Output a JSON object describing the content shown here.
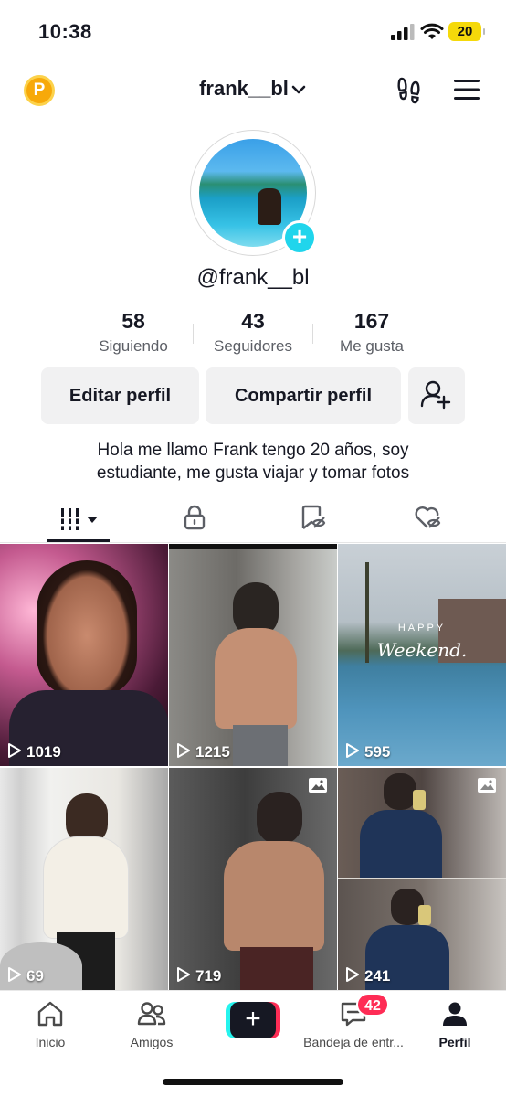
{
  "status_bar": {
    "time": "10:38",
    "battery": "20"
  },
  "header": {
    "username": "frank__bl",
    "coin_letter": "P"
  },
  "profile": {
    "handle": "@frank__bl",
    "stats": [
      {
        "value": "58",
        "label": "Siguiendo"
      },
      {
        "value": "43",
        "label": "Seguidores"
      },
      {
        "value": "167",
        "label": "Me gusta"
      }
    ],
    "buttons": {
      "edit": "Editar perfil",
      "share": "Compartir perfil"
    },
    "bio": [
      "Hola me llamo Frank tengo 20 años, soy",
      "estudiante, me gusta viajar y tomar fotos"
    ]
  },
  "videos": [
    {
      "views": "1019",
      "type": "video"
    },
    {
      "views": "1215",
      "type": "video"
    },
    {
      "views": "595",
      "type": "video"
    },
    {
      "views": "69",
      "type": "video"
    },
    {
      "views": "719",
      "type": "photo"
    },
    {
      "views": "241",
      "type": "photo"
    }
  ],
  "overlay_text": {
    "happy": "HAPPY",
    "weekend": "Weekend."
  },
  "bottom_nav": {
    "home": "Inicio",
    "friends": "Amigos",
    "inbox": "Bandeja de entr...",
    "inbox_badge": "42",
    "profile": "Perfil"
  },
  "colors": {
    "accent_red": "#fe2c55",
    "accent_cyan": "#25f4ee",
    "badge_cyan": "#20d5ec"
  }
}
